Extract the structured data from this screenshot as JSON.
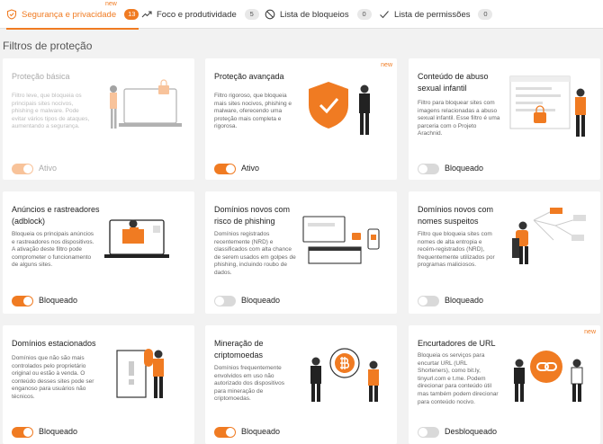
{
  "tabs": [
    {
      "label": "Segurança e privacidade",
      "count": "13",
      "new": "new"
    },
    {
      "label": "Foco e produtividade",
      "count": "5"
    },
    {
      "label": "Lista de bloqueios",
      "count": "0"
    },
    {
      "label": "Lista de permissões",
      "count": "0"
    }
  ],
  "section_title": "Filtros de proteção",
  "cards": [
    {
      "title": "Proteção básica",
      "desc": "Filtro leve, que bloqueia os principais sites nocivos, phishing e malware. Pode evitar vários tipos de ataques, aumentando a segurança.",
      "status": "Ativo"
    },
    {
      "title": "Proteção avançada",
      "desc": "Filtro rigoroso, que bloqueia mais sites nocivos, phishing e malware, oferecendo uma proteção mais completa e rigorosa.",
      "status": "Ativo",
      "new": "new"
    },
    {
      "title": "Conteúdo de abuso sexual infantil",
      "desc": "Filtro para bloquear sites com imagens relacionadas a abuso sexual infantil. Esse filtro é uma parceria com o Projeto Arachnid.",
      "status": "Bloqueado"
    },
    {
      "title": "Anúncios e rastreadores (adblock)",
      "desc": "Bloqueia os principais anúncios e rastreadores nos dispositivos. A ativação deste filtro pode comprometer o funcionamento de alguns sites.",
      "status": "Bloqueado"
    },
    {
      "title": "Domínios novos com risco de phishing",
      "desc": "Domínios registrados recentemente (NRD) e classificados com alta chance de serem usados em golpes de phishing, incluindo roubo de dados.",
      "status": "Bloqueado"
    },
    {
      "title": "Domínios novos com nomes suspeitos",
      "desc": "Filtro que bloqueia sites com nomes de alta entropia e recém-registrados (NRD), frequentemente utilizados por programas maliciosos.",
      "status": "Bloqueado"
    },
    {
      "title": "Domínios estacionados",
      "desc": "Domínios que não são mais controlados pelo proprietário original ou estão à venda. O conteúdo desses sites pode ser enganoso para usuários não técnicos.",
      "status": "Bloqueado"
    },
    {
      "title": "Mineração de criptomoedas",
      "desc": "Domínios frequentemente envolvidos em uso não autorizado dos dispositivos para mineração de criptomoedas.",
      "status": "Bloqueado"
    },
    {
      "title": "Encurtadores de URL",
      "desc": "Bloqueia os serviços para encurtar URL (URL Shorteners), como bit.ly, tinyurl.com e t.me. Podem direcionar para conteúdo útil mas também podem direcionar para conteúdo nocivo.",
      "status": "Desbloqueado",
      "new": "new"
    }
  ],
  "icons": [
    "shield-check-icon",
    "trend-up-icon",
    "block-icon",
    "check-icon"
  ],
  "colors": {
    "accent": "#f07b22",
    "toggle_off": "#d9d9d9"
  }
}
